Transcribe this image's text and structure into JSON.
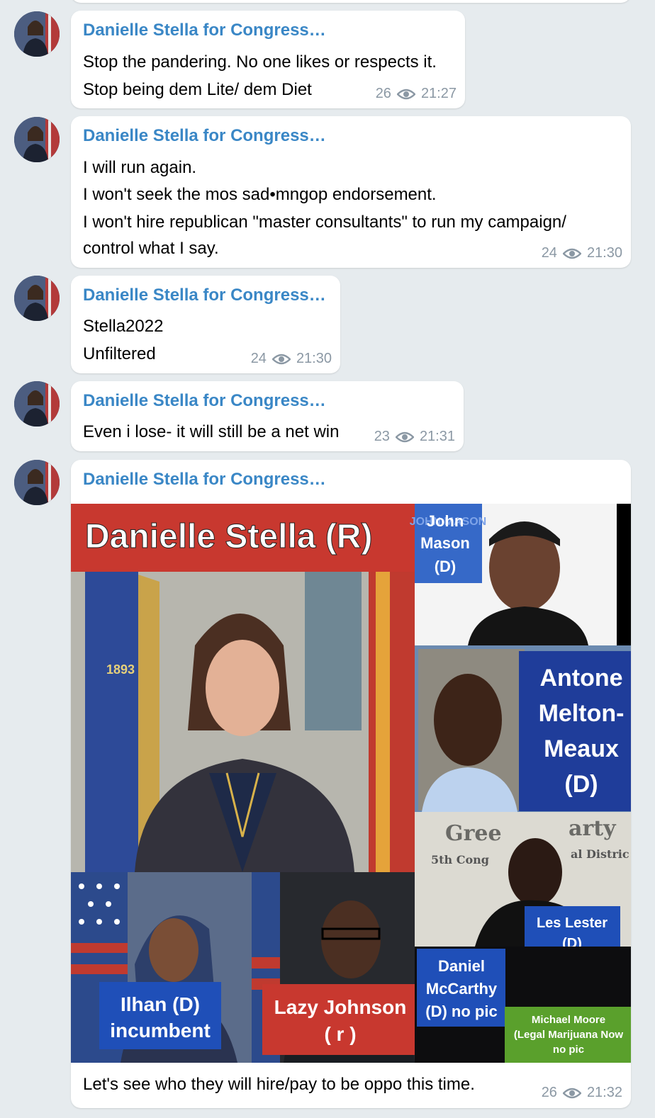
{
  "sender": "Danielle Stella for Congress…",
  "messages": [
    {
      "lines": [
        "Stop the pandering. No one likes or respects it.",
        "Stop being dem Lite/ dem Diet"
      ],
      "views": "26",
      "time": "21:27"
    },
    {
      "lines": [
        "I will run again.",
        "I won't seek the mos sad•mngop endorsement.",
        "I won't hire republican \"master consultants\" to run my campaign/",
        "control what I say."
      ],
      "views": "24",
      "time": "21:30"
    },
    {
      "lines": [
        "Stella2022",
        "Unfiltered"
      ],
      "views": "24",
      "time": "21:30"
    },
    {
      "lines": [
        "Even i lose- it will still be a net win"
      ],
      "views": "23",
      "time": "21:31"
    },
    {
      "caption": "Let's see who they will hire/pay to be oppo this time.",
      "views": "26",
      "time": "21:32"
    }
  ],
  "image_labels": {
    "stella": "Danielle Stella (R)",
    "mason": [
      "John",
      "Mason",
      "(D)"
    ],
    "mason_sign": "JOHN MASON",
    "melton": [
      "Antone",
      "Melton-",
      "Meaux",
      "(D)"
    ],
    "green_top_left": "Gree",
    "green_top_right": "arty",
    "green_sub_left": "5th Cong",
    "green_sub_right": "al Distric",
    "lester": [
      "Les Lester",
      "(D)"
    ],
    "ilhan": [
      "Ilhan (D)",
      "incumbent"
    ],
    "johnson": [
      "Lazy Johnson",
      "( r )"
    ],
    "mccarthy": [
      "Daniel",
      "McCarthy",
      "(D) no pic"
    ],
    "moore": [
      "Michael Moore",
      "(Legal Marijuana Now",
      "no pic"
    ],
    "flag_year": "1893"
  },
  "colors": {
    "background": "#e6ebee",
    "sender": "#3a87c6",
    "meta": "#8b98a4",
    "red_banner": "#c8382f",
    "blue_label": "#1f4fb8",
    "green_label": "#5aa02c"
  },
  "icons": {
    "views": "eye-icon",
    "avatar": "avatar-photo"
  }
}
